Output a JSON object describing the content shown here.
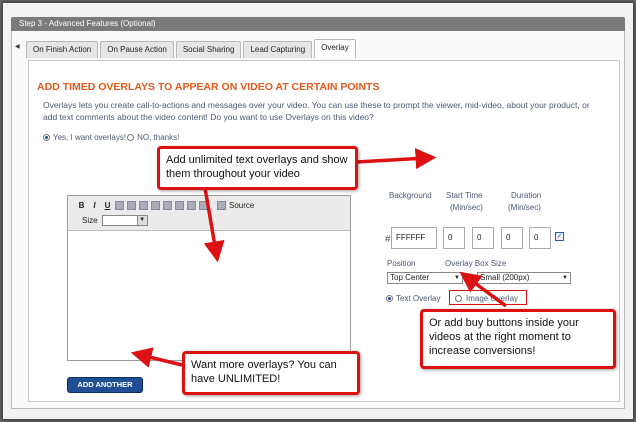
{
  "step_title": "Step 3 - Advanced Features (Optional)",
  "tabs": [
    {
      "label": "On Finish Action",
      "active": false
    },
    {
      "label": "On Pause Action",
      "active": false
    },
    {
      "label": "Social Sharing",
      "active": false
    },
    {
      "label": "Lead Capturing",
      "active": false
    },
    {
      "label": "Overlay",
      "active": true
    }
  ],
  "heading": "ADD TIMED OVERLAYS TO APPEAR ON VIDEO AT CERTAIN POINTS",
  "description": "Overlays lets you create call-to-actions and messages over your video. You can use these to prompt the viewer, mid-video, about your product, or add text comments about the video content! Do you want to use Overlays on this video?",
  "overlay_choice": {
    "yes_label": "Yes, I want overlays!",
    "no_label": "NO, thanks!",
    "selected": "yes"
  },
  "editor": {
    "source_label": "Source",
    "size_label": "Size",
    "size_value": "",
    "buttons": [
      "B",
      "I",
      "U"
    ]
  },
  "settings": {
    "background_label": "Background",
    "start_time_label": "Start Time",
    "start_time_unit": "(Min/sec)",
    "duration_label": "Duration",
    "duration_unit": "(Min/sec)",
    "hash": "#",
    "background_value": "FFFFFF",
    "start_min": "0",
    "start_sec": "0",
    "duration_min": "0",
    "duration_sec": "0",
    "checkbox_checked": true,
    "position_label": "Position",
    "position_value": "Top Center",
    "box_size_label": "Overlay Box Size",
    "box_size_value": "Small (200px)",
    "text_overlay_label": "Text Overlay",
    "image_overlay_label": "Image Overlay",
    "overlay_type": "text"
  },
  "add_button_label": "ADD ANOTHER",
  "callouts": {
    "text_overlays": "Add unlimited text overlays and show them throughout your video",
    "buy_buttons": "Or add buy buttons inside your videos at the right moment to increase conversions!",
    "more_overlays": "Want more overlays? You can have UNLIMITED!"
  },
  "colors": {
    "accent": "#e25a1c",
    "callout_border": "#dd1111",
    "button": "#1f4f92"
  }
}
